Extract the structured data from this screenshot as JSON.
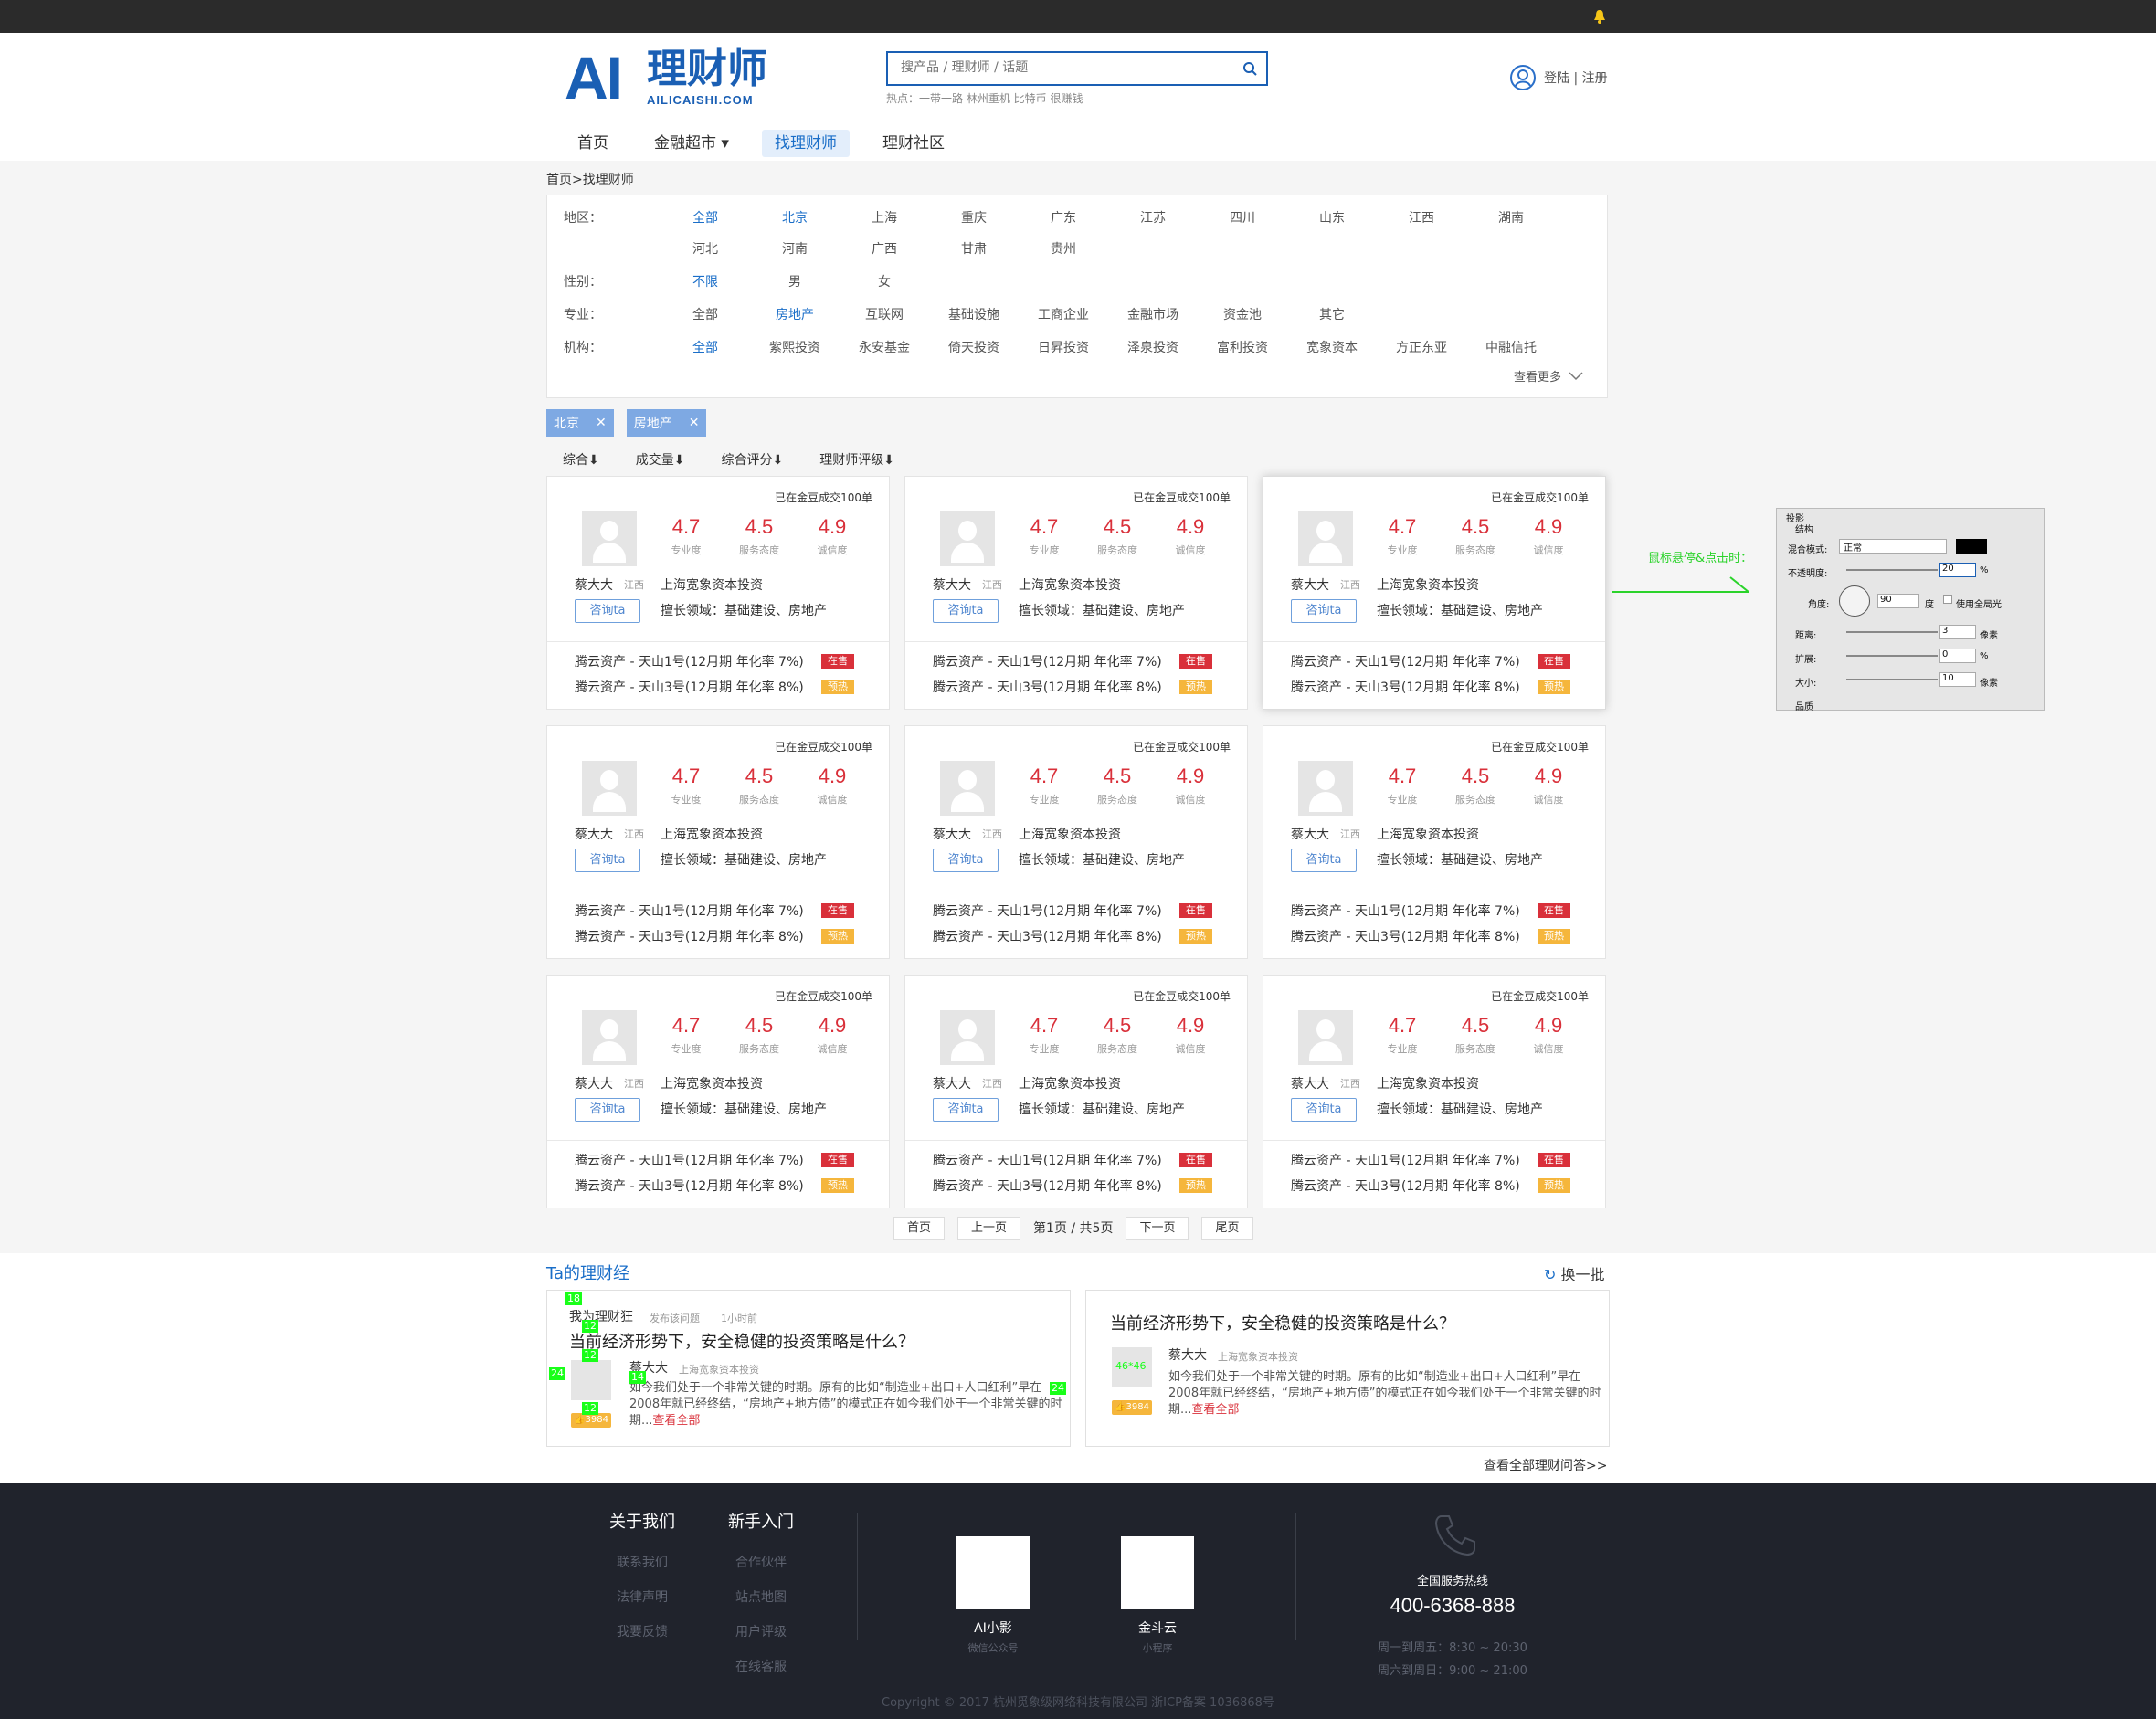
{
  "header": {
    "logo_mark": "AI",
    "logo_cn": "理财师",
    "logo_sub": "AILICAISHI.COM",
    "search_placeholder": "搜产品 / 理财师 / 话题",
    "hot": "热点：一带一路 林州重机 比特币 很赚钱",
    "login": "登陆 | 注册"
  },
  "nav": [
    "首页",
    "金融超市",
    "找理财师",
    "理财社区"
  ],
  "breadcrumb": "首页>找理财师",
  "filters": {
    "region_label": "地区：",
    "region_row1": [
      "全部",
      "北京",
      "上海",
      "重庆",
      "广东",
      "江苏",
      "四川",
      "山东",
      "江西",
      "湖南"
    ],
    "region_row2": [
      "河北",
      "河南",
      "广西",
      "甘肃",
      "贵州"
    ],
    "gender_label": "性别：",
    "gender": [
      "不限",
      "男",
      "女"
    ],
    "major_label": "专业：",
    "major": [
      "全部",
      "房地产",
      "互联网",
      "基础设施",
      "工商企业",
      "金融市场",
      "资金池",
      "其它"
    ],
    "org_label": "机构：",
    "org": [
      "全部",
      "紫熙投资",
      "永安基金",
      "倚天投资",
      "日昇投资",
      "泽泉投资",
      "富利投资",
      "宽象资本",
      "方正东亚",
      "中融信托"
    ],
    "more": "查看更多"
  },
  "selected_tags": [
    "北京",
    "房地产"
  ],
  "sorts": [
    "综合⬇",
    "成交量⬇",
    "综合评分⬇",
    "理财师评级⬇"
  ],
  "card": {
    "deal": "已在金豆成交100单",
    "scores": [
      {
        "value": "4.7",
        "label": "专业度"
      },
      {
        "value": "4.5",
        "label": "服务态度"
      },
      {
        "value": "4.9",
        "label": "诚信度"
      }
    ],
    "name": "蔡大大",
    "province": "江西",
    "org": "上海宽象资本投资",
    "ask": "咨询ta",
    "field": "擅长领域：基础建设、房地产",
    "products": [
      {
        "title": "腾云资产 - 天山1号(12月期 年化率 7%)",
        "badge": "在售"
      },
      {
        "title": "腾云资产 - 天山3号(12月期 年化率 8%)",
        "badge": "预热"
      }
    ]
  },
  "pager": {
    "first": "首页",
    "prev": "上一页",
    "info": "第1页 / 共5页",
    "next": "下一页",
    "last": "尾页"
  },
  "annotation": {
    "hover_label": "鼠标悬停&点击时：",
    "title": "投影",
    "section": "结构",
    "blend_label": "混合模式:",
    "blend_value": "正常",
    "opacity_label": "不透明度:",
    "opacity_value": "20",
    "pct": "%",
    "angle_label": "角度:",
    "angle_value": "90",
    "deg": "度",
    "global_light": "使用全局光",
    "distance_label": "距离:",
    "distance_value": "3",
    "px": "像素",
    "spread_label": "扩展:",
    "spread_value": "0",
    "size_label": "大小:",
    "size_value": "10",
    "bottom": "品质"
  },
  "qa": {
    "title": "Ta的理财经",
    "refresh": "换一批",
    "left": {
      "asker": "我为理财狂",
      "asked": "发布该问题",
      "time": "1小时前",
      "question": "当前经济形势下，安全稳健的投资策略是什么？",
      "answerer": "蔡大大",
      "answerer_org": "上海宽象资本投资",
      "answer": "如今我们处于一个非常关键的时期。原有的比如“制造业+出口+人口红利”早在2008年就已经终结，“房地产+地方债”的模式正在如今我们处于一个非常关键的时期...",
      "read_more": "查看全部",
      "likes": "3984",
      "marks": [
        "18",
        "12",
        "12",
        "24",
        "14",
        "12",
        "24"
      ]
    },
    "right": {
      "question": "当前经济形势下，安全稳健的投资策略是什么？",
      "answerer": "蔡大大",
      "answerer_org": "上海宽象资本投资",
      "answer": "如今我们处于一个非常关键的时期。原有的比如“制造业+出口+人口红利”早在2008年就已经终结，“房地产+地方债”的模式正在如今我们处于一个非常关键的时期...",
      "read_more": "查看全部",
      "likes": "3984",
      "avatar_mark": "46*46"
    },
    "all": "查看全部理财问答>>"
  },
  "footer": {
    "about_title": "关于我们",
    "about": [
      "联系我们",
      "法律声明",
      "我要反馈"
    ],
    "newbie_title": "新手入门",
    "newbie": [
      "合作伙伴",
      "站点地图",
      "用户评级",
      "在线客服"
    ],
    "qr1_name": "AI小影",
    "qr1_desc": "微信公众号",
    "qr2_name": "金斗云",
    "qr2_desc": "小程序",
    "hotline_label": "全国服务热线",
    "hotline": "400-6368-888",
    "hours1": "周一到周五：8:30 ~ 20:30",
    "hours2": "周六到周日：9:00 ~ 21:00",
    "copyright": "Copyright © 2017 杭州觅象级网络科技有限公司 浙ICP备案 1036868号"
  }
}
